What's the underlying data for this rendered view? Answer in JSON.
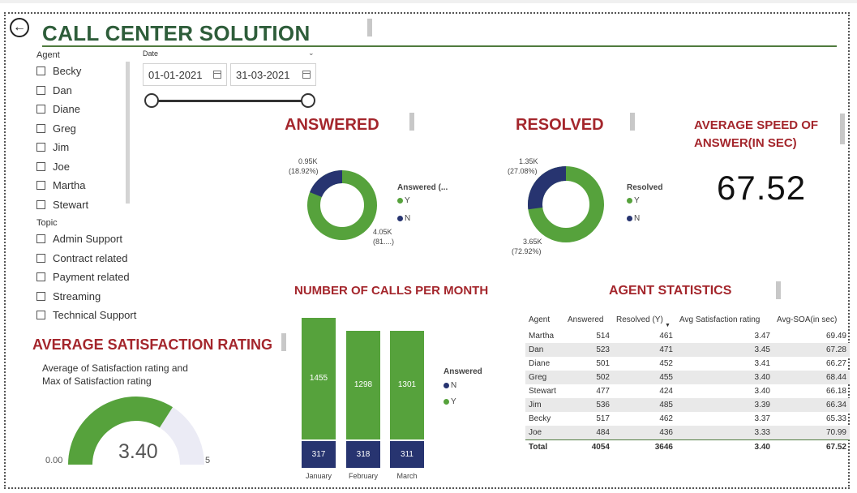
{
  "header": {
    "title": "CALL CENTER SOLUTION",
    "back_icon": "back-arrow-icon"
  },
  "slicers": {
    "agent": {
      "label": "Agent",
      "options": [
        "Becky",
        "Dan",
        "Diane",
        "Greg",
        "Jim",
        "Joe",
        "Martha",
        "Stewart"
      ]
    },
    "topic": {
      "label": "Topic",
      "options": [
        "Admin Support",
        "Contract related",
        "Payment related",
        "Streaming",
        "Technical Support"
      ]
    },
    "date": {
      "label": "Date",
      "start": "01-01-2021",
      "end": "31-03-2021",
      "range_start_fraction": 0,
      "range_end_fraction": 1
    }
  },
  "answered": {
    "heading": "ANSWERED",
    "legend_title": "Answered (...",
    "legend": [
      "Y",
      "N"
    ],
    "label_n": {
      "value": "0.95K",
      "pct": "(18.92%)"
    },
    "label_y": {
      "value": "4.05K",
      "pct": "(81....)"
    }
  },
  "resolved": {
    "heading": "RESOLVED",
    "legend_title": "Resolved",
    "legend": [
      "Y",
      "N"
    ],
    "label_n": {
      "value": "1.35K",
      "pct": "(27.08%)"
    },
    "label_y": {
      "value": "3.65K",
      "pct": "(72.92%)"
    }
  },
  "speed": {
    "heading_line1": "AVERAGE SPEED OF",
    "heading_line2": "ANSWER(IN SEC)",
    "value": "67.52"
  },
  "satisfaction": {
    "heading": "AVERAGE SATISFACTION RATING",
    "caption_line1": "Average of Satisfaction rating and",
    "caption_line2": "Max of Satisfaction rating",
    "value": "3.40",
    "min": "0.00",
    "max": "5"
  },
  "calls": {
    "heading": "NUMBER OF CALLS PER MONTH",
    "legend_title": "Answered",
    "legend": [
      "N",
      "Y"
    ],
    "months": [
      "January",
      "February",
      "March"
    ],
    "y_values": [
      "1455",
      "1298",
      "1301"
    ],
    "n_values": [
      "317",
      "318",
      "311"
    ]
  },
  "agent_stats": {
    "heading": "AGENT STATISTICS",
    "columns": [
      "Agent",
      "Answered",
      "Resolved (Y)",
      "Avg Satisfaction rating",
      "Avg-SOA(in sec)"
    ],
    "rows": [
      [
        "Martha",
        "514",
        "461",
        "3.47",
        "69.49"
      ],
      [
        "Dan",
        "523",
        "471",
        "3.45",
        "67.28"
      ],
      [
        "Diane",
        "501",
        "452",
        "3.41",
        "66.27"
      ],
      [
        "Greg",
        "502",
        "455",
        "3.40",
        "68.44"
      ],
      [
        "Stewart",
        "477",
        "424",
        "3.40",
        "66.18"
      ],
      [
        "Jim",
        "536",
        "485",
        "3.39",
        "66.34"
      ],
      [
        "Becky",
        "517",
        "462",
        "3.37",
        "65.33"
      ],
      [
        "Joe",
        "484",
        "436",
        "3.33",
        "70.99"
      ]
    ],
    "total": [
      "Total",
      "4054",
      "3646",
      "3.40",
      "67.52"
    ]
  },
  "colors": {
    "green": "#56a23c",
    "navy": "#273470",
    "red": "#a4262c",
    "title_green": "#2e5d3a",
    "gauge_bg": "#ebebf5"
  }
}
